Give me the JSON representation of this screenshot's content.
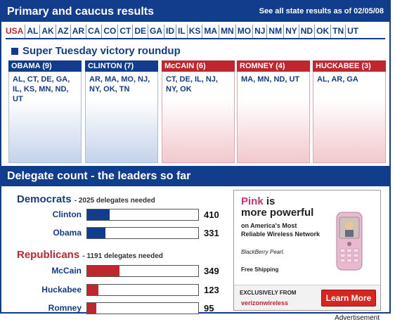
{
  "results": {
    "title": "Primary and caucus results",
    "all_states_link": "See all state results as of 02/05/08"
  },
  "states": [
    "USA",
    "AL",
    "AK",
    "AZ",
    "AR",
    "CA",
    "CO",
    "CT",
    "DE",
    "GA",
    "ID",
    "IL",
    "KS",
    "MA",
    "MN",
    "MO",
    "NJ",
    "NM",
    "NY",
    "ND",
    "OK",
    "TN",
    "UT"
  ],
  "roundup": {
    "title": "Super Tuesday victory roundup",
    "candidates": [
      {
        "header": "OBAMA (9)",
        "states": "AL, CT, DE, GA, IL, KS, MN, ND, UT"
      },
      {
        "header": "CLINTON (7)",
        "states": "AR, MA, MO, NJ, NY, OK, TN"
      },
      {
        "header": "McCAIN (6)",
        "states": "CT, DE, IL, NJ, NY, OK"
      },
      {
        "header": "ROMNEY (4)",
        "states": "MA, MN, ND, UT"
      },
      {
        "header": "HUCKABEE (3)",
        "states": "AL, AR, GA"
      }
    ]
  },
  "delegates": {
    "title": "Delegate count - the leaders so far",
    "democrats": {
      "label": "Democrats",
      "needed": "- 2025 delegates needed",
      "color": "#123d8c",
      "rows": [
        {
          "name": "Clinton",
          "count": "410",
          "fraction": 0.202
        },
        {
          "name": "Obama",
          "count": "331",
          "fraction": 0.163
        }
      ]
    },
    "republicans": {
      "label": "Republicans",
      "needed": "- 1191 delegates needed",
      "color": "#c0262e",
      "rows": [
        {
          "name": "McCain",
          "count": "349",
          "fraction": 0.293
        },
        {
          "name": "Huckabee",
          "count": "123",
          "fraction": 0.103
        },
        {
          "name": "Romney",
          "count": "95",
          "fraction": 0.08
        }
      ]
    }
  },
  "ad": {
    "pink": "Pink",
    "headline_rest": "is",
    "headline_line2": "more powerful",
    "sub_line1": "on America's Most",
    "sub_line2": "Reliable Wireless Network",
    "blackberry": "BlackBerry Pearl.",
    "free_shipping": "Free Shipping",
    "exclusively": "EXCLUSIVELY FROM",
    "verizon": "verizonwireless",
    "cta": "Learn More",
    "caption": "Advertisement"
  }
}
